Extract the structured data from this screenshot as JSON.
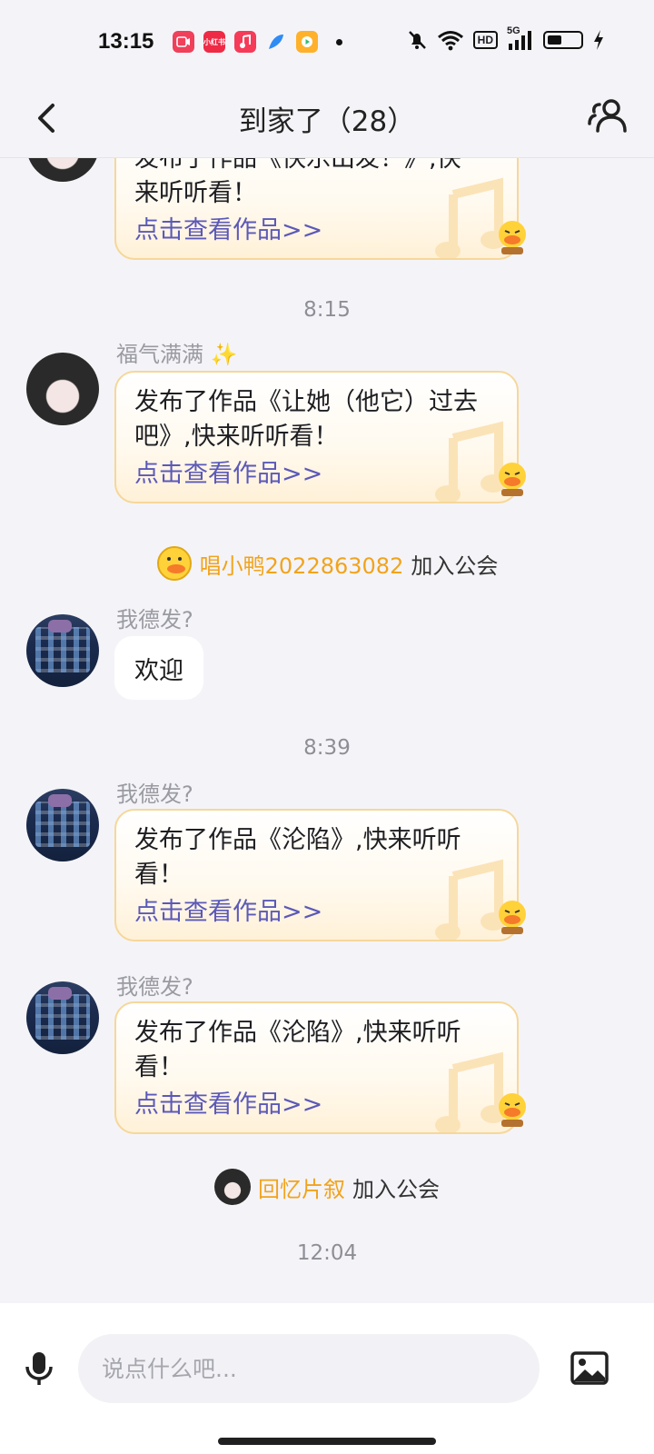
{
  "status_bar": {
    "time": "13:15",
    "app_icons": [
      "screen-recorder-icon",
      "xiaohongshu-icon",
      "music-icon",
      "feather-icon",
      "video-app-icon"
    ],
    "app_label_small": "小红书",
    "network": "5G",
    "hd_label": "HD",
    "battery_level": 0.45
  },
  "header": {
    "title": "到家了（28）",
    "back_icon": "chevron-left-icon",
    "members_icon": "group-members-icon"
  },
  "messages": [
    {
      "type": "work_card",
      "sender": "",
      "text": "发布了作品《快乐出发！》,快来听听看！",
      "link": "点击查看作品>>"
    },
    {
      "type": "time",
      "text": "8:15"
    },
    {
      "type": "work_card",
      "sender": "福气满满 ✨",
      "text": "发布了作品《让她（他它）过去吧》,快来听听看！",
      "link": "点击查看作品>>"
    },
    {
      "type": "system",
      "name": "唱小鸭2022863082",
      "action": "加入公会"
    },
    {
      "type": "text",
      "sender": "我德发?",
      "text": "欢迎"
    },
    {
      "type": "time",
      "text": "8:39"
    },
    {
      "type": "work_card",
      "sender": "我德发?",
      "text": "发布了作品《沦陷》,快来听听看！",
      "link": "点击查看作品>>"
    },
    {
      "type": "work_card",
      "sender": "我德发?",
      "text": "发布了作品《沦陷》,快来听听看！",
      "link": "点击查看作品>>"
    },
    {
      "type": "system",
      "name": "回忆片叙",
      "action": "加入公会"
    },
    {
      "type": "time",
      "text": "12:04"
    }
  ],
  "input_bar": {
    "placeholder": "说点什么吧...",
    "mic_icon": "microphone-icon",
    "image_icon": "image-icon"
  },
  "colors": {
    "background": "#f4f4f8",
    "link": "#5b59b8",
    "system_name": "#f2a31c",
    "card_border": "#f6d79a"
  }
}
